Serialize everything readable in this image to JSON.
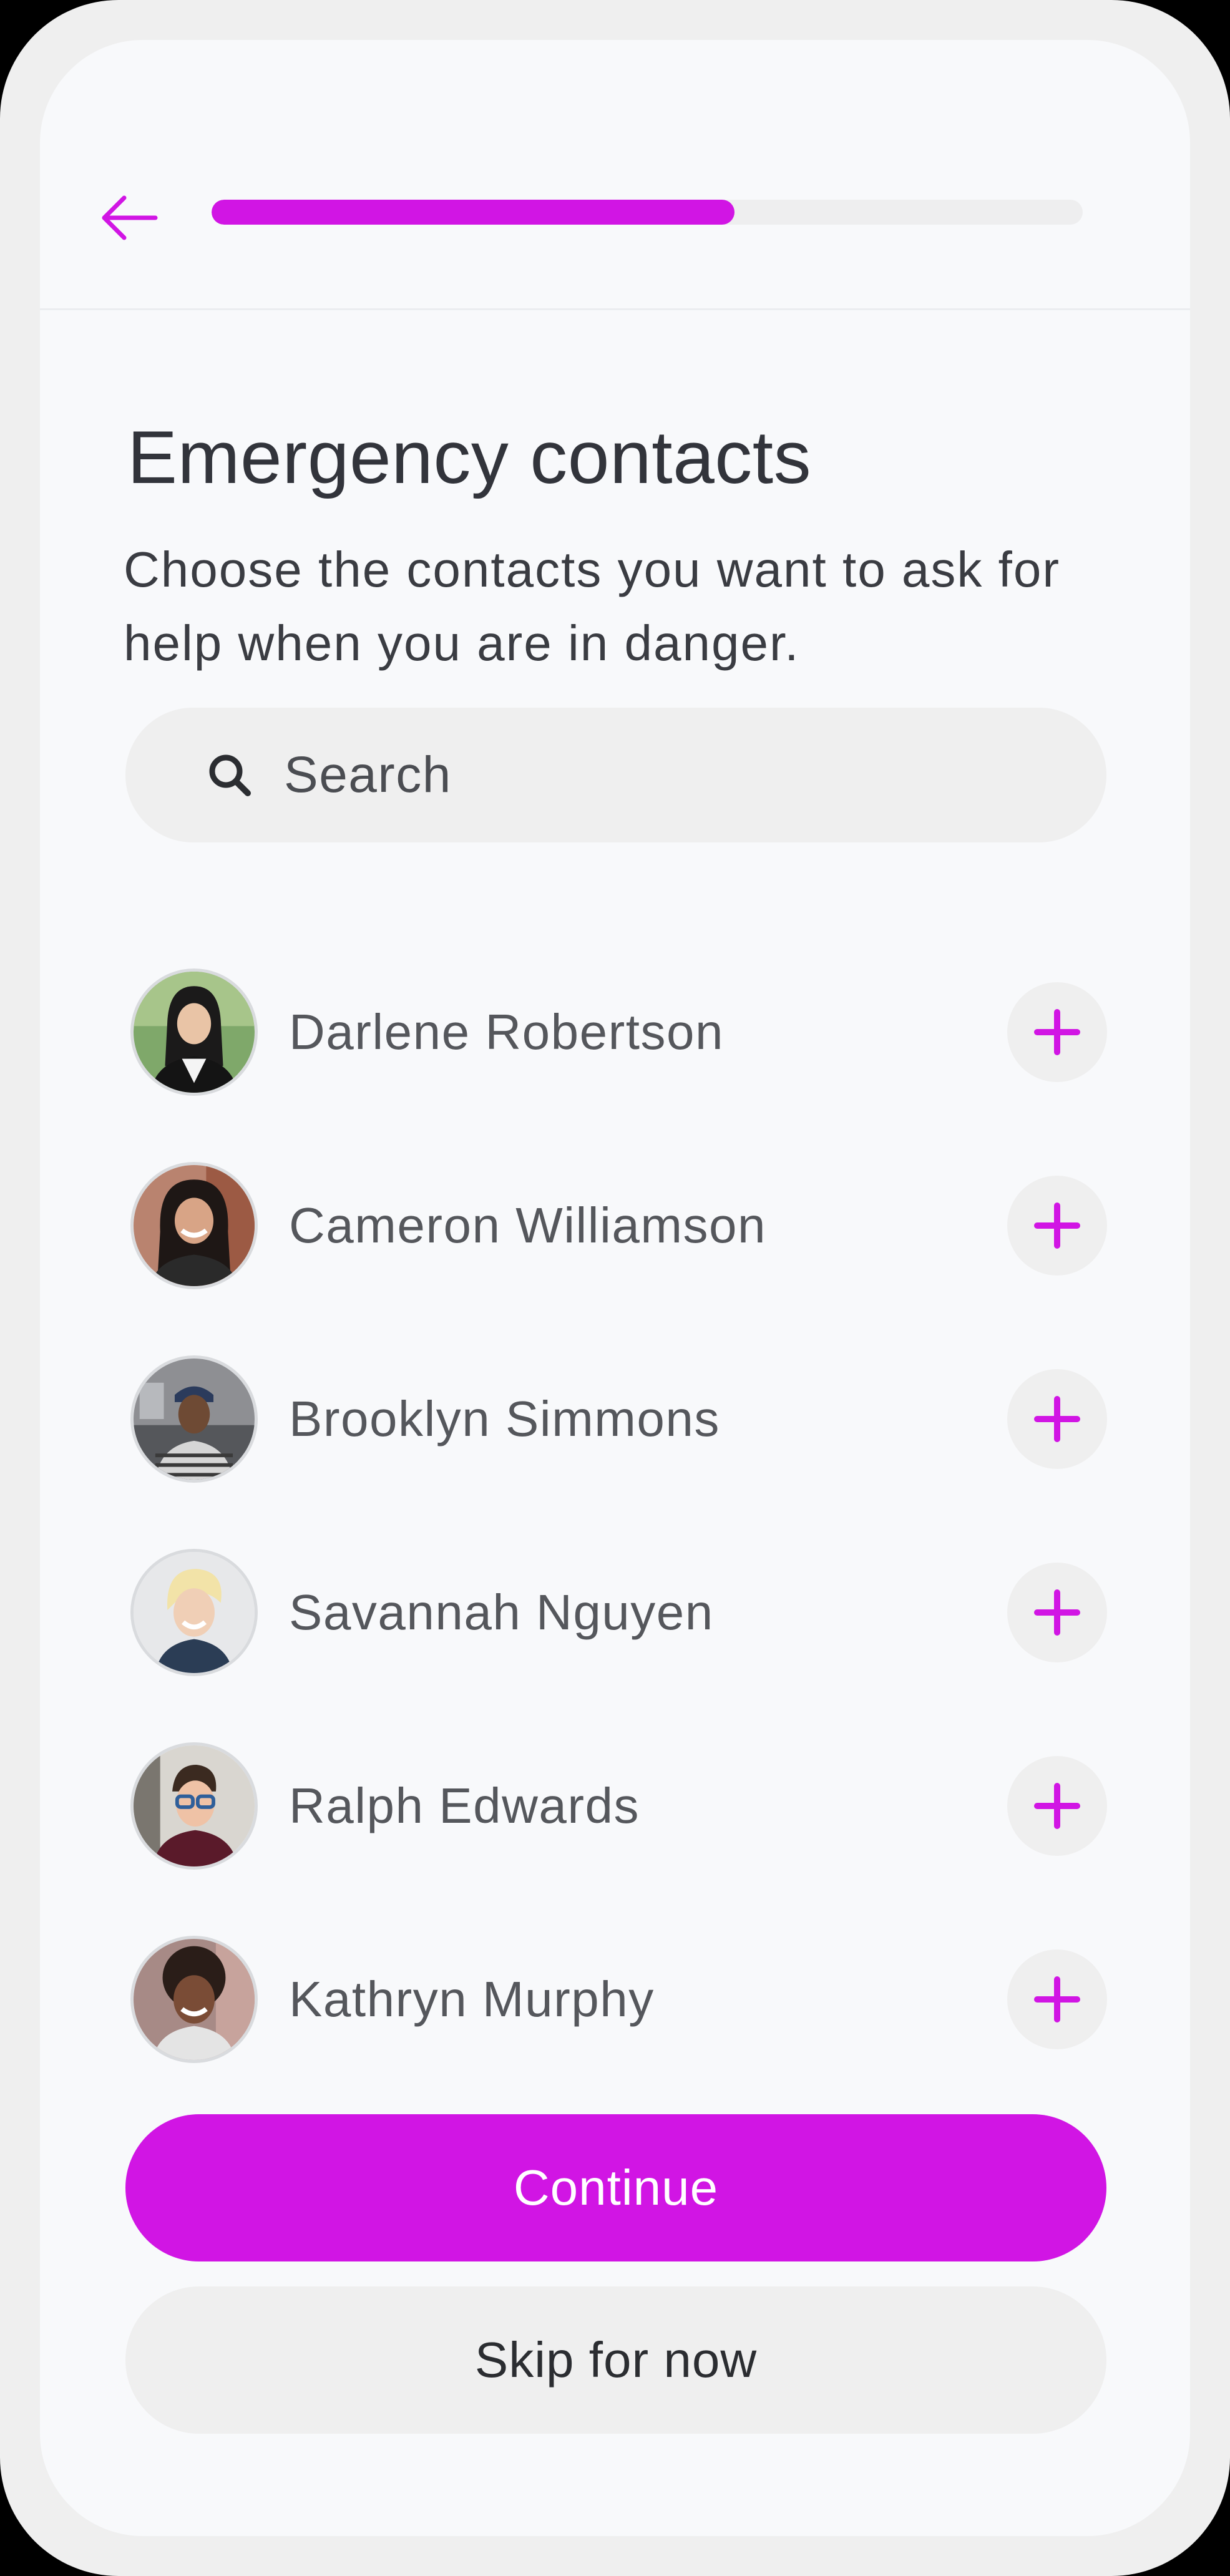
{
  "header": {
    "back_icon": "arrow-left-icon",
    "progress_fraction": 0.6
  },
  "title": "Emergency contacts",
  "subtitle": "Choose the contacts you want to ask for help when you are in danger.",
  "search": {
    "placeholder": "Search",
    "icon": "search-icon"
  },
  "contacts": [
    {
      "name": "Darlene Robertson"
    },
    {
      "name": "Cameron Williamson"
    },
    {
      "name": "Brooklyn Simmons"
    },
    {
      "name": "Savannah Nguyen"
    },
    {
      "name": "Ralph Edwards"
    },
    {
      "name": "Kathryn Murphy"
    }
  ],
  "add_icon": "plus-icon",
  "buttons": {
    "continue_label": "Continue",
    "skip_label": "Skip for now"
  },
  "colors": {
    "accent": "#d115e4",
    "background": "#f8f9fb",
    "surface": "#efefef",
    "text": "#32343b"
  }
}
